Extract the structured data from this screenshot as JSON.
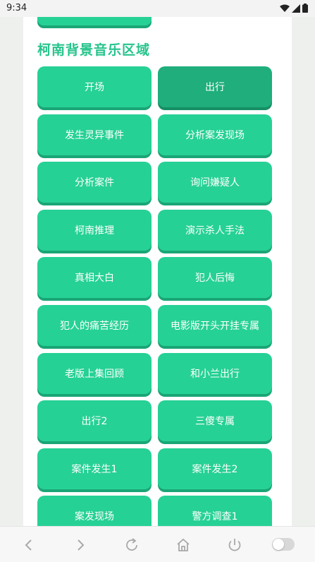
{
  "status_bar": {
    "time": "9:34",
    "icons": [
      "wifi-icon",
      "cell-signal-icon",
      "battery-icon"
    ]
  },
  "section": {
    "title": "柯南背景音乐区域"
  },
  "buttons": [
    {
      "label": "开场",
      "active": false
    },
    {
      "label": "出行",
      "active": true
    },
    {
      "label": "发生灵异事件",
      "active": false
    },
    {
      "label": "分析案发现场",
      "active": false
    },
    {
      "label": "分析案件",
      "active": false
    },
    {
      "label": "询问嫌疑人",
      "active": false
    },
    {
      "label": "柯南推理",
      "active": false
    },
    {
      "label": "演示杀人手法",
      "active": false
    },
    {
      "label": "真相大白",
      "active": false
    },
    {
      "label": "犯人后悔",
      "active": false
    },
    {
      "label": "犯人的痛苦经历",
      "active": false
    },
    {
      "label": "电影版开头开挂专属",
      "active": false
    },
    {
      "label": "老版上集回顾",
      "active": false
    },
    {
      "label": "和小兰出行",
      "active": false
    },
    {
      "label": "出行2",
      "active": false
    },
    {
      "label": "三傻专属",
      "active": false
    },
    {
      "label": "案件发生1",
      "active": false
    },
    {
      "label": "案件发生2",
      "active": false
    },
    {
      "label": "案发现场",
      "active": false
    },
    {
      "label": "警方调查1",
      "active": false
    }
  ],
  "bottom_nav": {
    "icons": [
      "back-icon",
      "forward-icon",
      "refresh-icon",
      "home-icon",
      "power-icon",
      "toggle-switch"
    ]
  },
  "colors": {
    "accent": "#26d195",
    "accent_dark": "#1aa676",
    "active": "#1fae7c",
    "title": "#26c48c"
  }
}
